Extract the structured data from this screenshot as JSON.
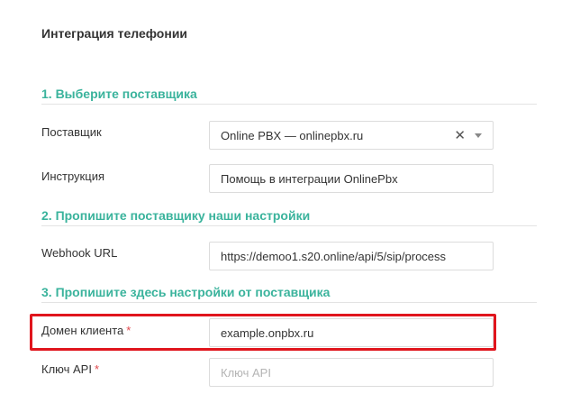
{
  "page_title": "Интеграция телефонии",
  "sections": {
    "provider": "1. Выберите поставщика",
    "our_settings": "2. Пропишите поставщику наши настройки",
    "provider_settings": "3. Пропишите здесь настройки от поставщика"
  },
  "fields": {
    "provider": {
      "label": "Поставщик",
      "value": "Online PBX — onlinepbx.ru"
    },
    "instruction": {
      "label": "Инструкция",
      "value": "Помощь в интеграции OnlinePbx"
    },
    "webhook": {
      "label": "Webhook URL",
      "value": "https://demoo1.s20.online/api/5/sip/process"
    },
    "client_domain": {
      "label": "Домен клиента",
      "required_mark": "*",
      "value": "example.onpbx.ru"
    },
    "api_key": {
      "label": "Ключ API",
      "required_mark": "*",
      "value": "",
      "placeholder": "Ключ API"
    }
  },
  "icons": {
    "clear": "close-icon",
    "dropdown": "chevron-down-icon"
  },
  "colors": {
    "section_heading": "#3ab39c",
    "required": "#e0474c",
    "highlight": "#e0151d"
  }
}
